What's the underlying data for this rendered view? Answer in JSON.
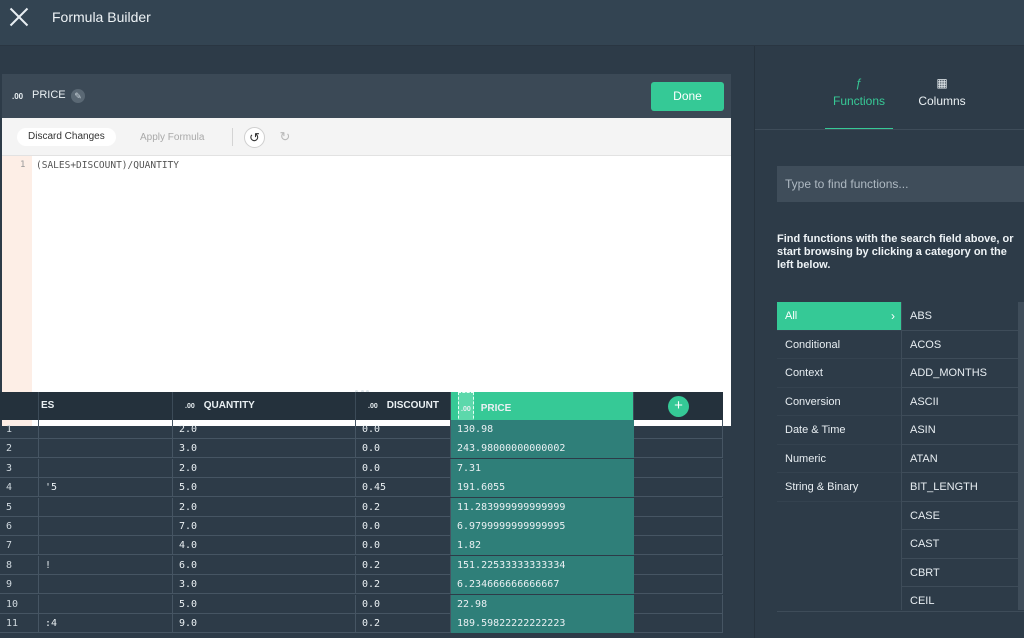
{
  "app": {
    "title": "Formula Builder"
  },
  "editor": {
    "format_badge": ".00",
    "column_name": "PRICE",
    "done_label": "Done",
    "discard_label": "Discard Changes",
    "apply_label": "Apply Formula",
    "line_number": "1",
    "formula": "(SALES+DISCOUNT)/QUANTITY"
  },
  "grid": {
    "headers": [
      {
        "fmt": "",
        "label": "ES"
      },
      {
        "fmt": ".00",
        "label": "QUANTITY"
      },
      {
        "fmt": ".00",
        "label": "DISCOUNT"
      },
      {
        "fmt": ".00",
        "label": "PRICE"
      }
    ],
    "rows": [
      {
        "n": "1",
        "s": "",
        "q": "2.0",
        "d": "0.0",
        "p": "130.98"
      },
      {
        "n": "2",
        "s": "",
        "q": "3.0",
        "d": "0.0",
        "p": "243.98000000000002"
      },
      {
        "n": "3",
        "s": "",
        "q": "2.0",
        "d": "0.0",
        "p": "7.31"
      },
      {
        "n": "4",
        "s": "'5",
        "q": "5.0",
        "d": "0.45",
        "p": "191.6055"
      },
      {
        "n": "5",
        "s": "",
        "q": "2.0",
        "d": "0.2",
        "p": "11.283999999999999"
      },
      {
        "n": "6",
        "s": "",
        "q": "7.0",
        "d": "0.0",
        "p": "6.9799999999999995"
      },
      {
        "n": "7",
        "s": "",
        "q": "4.0",
        "d": "0.0",
        "p": "1.82"
      },
      {
        "n": "8",
        "s": "!",
        "q": "6.0",
        "d": "0.2",
        "p": "151.22533333333334"
      },
      {
        "n": "9",
        "s": "",
        "q": "3.0",
        "d": "0.2",
        "p": "6.234666666666667"
      },
      {
        "n": "10",
        "s": "",
        "q": "5.0",
        "d": "0.0",
        "p": "22.98"
      },
      {
        "n": "11",
        "s": ":4",
        "q": "9.0",
        "d": "0.2",
        "p": "189.59822222222223"
      }
    ]
  },
  "panel": {
    "tabs": [
      {
        "icon": "ƒ",
        "label": "Functions"
      },
      {
        "icon": "▦",
        "label": "Columns"
      }
    ],
    "search_placeholder": "Type to find functions...",
    "help_text": "Find functions with the search field above, or start browsing by clicking a category on the left below.",
    "categories": [
      "All",
      "Conditional",
      "Context",
      "Conversion",
      "Date & Time",
      "Numeric",
      "String & Binary"
    ],
    "functions": [
      "ABS",
      "ACOS",
      "ADD_MONTHS",
      "ASCII",
      "ASIN",
      "ATAN",
      "BIT_LENGTH",
      "CASE",
      "CAST",
      "CBRT",
      "CEIL"
    ]
  },
  "colors": {
    "accent": "#35c996",
    "bg": "#2d3b48",
    "price_column": "#2f7f79"
  }
}
